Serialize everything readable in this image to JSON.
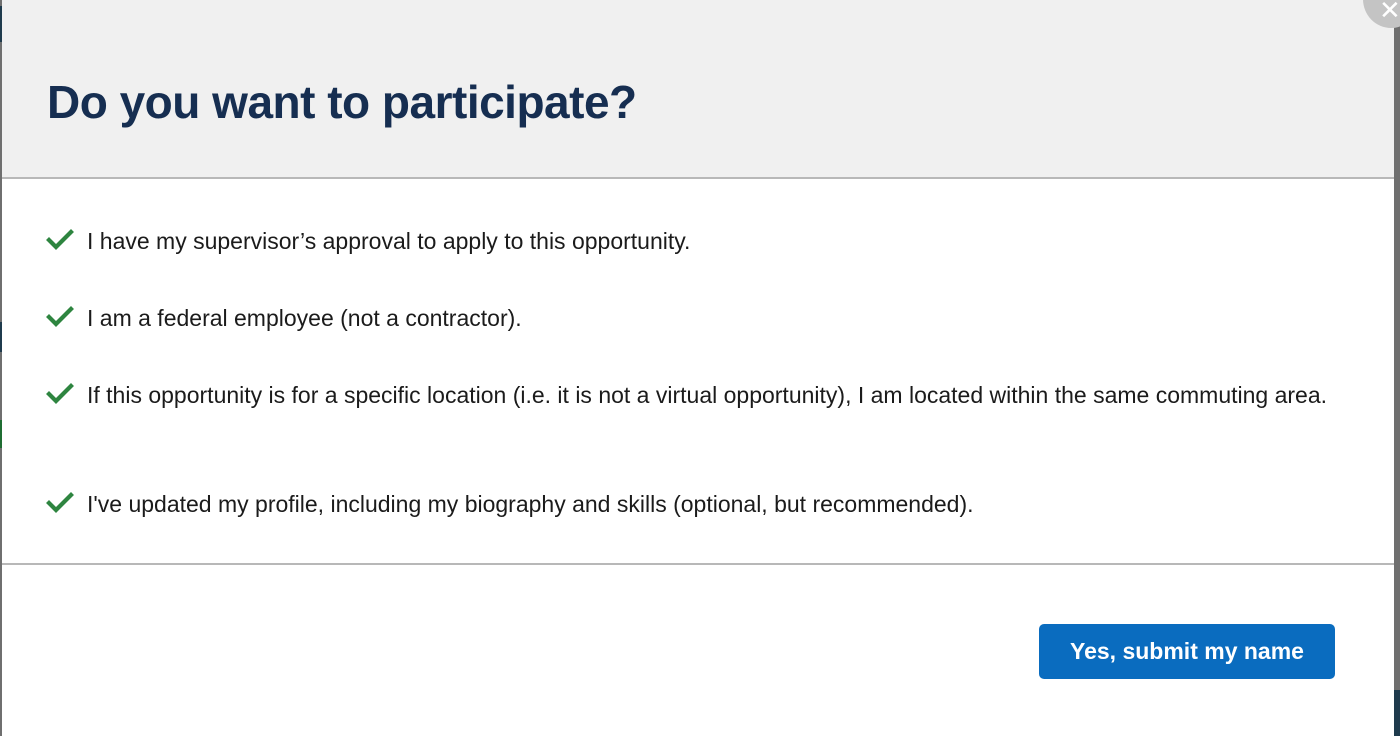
{
  "dialog": {
    "title": "Do you want to participate?",
    "close_label": "✕",
    "checklist": [
      {
        "icon": "checkmark-icon",
        "text": "I have my supervisor’s approval to apply to this opportunity."
      },
      {
        "icon": "checkmark-icon",
        "text": "I am a federal employee (not a contractor)."
      },
      {
        "icon": "checkmark-icon",
        "text": "If this opportunity is for a specific location (i.e. it is not a virtual opportunity), I am located within the same commuting area."
      },
      {
        "icon": "checkmark-icon",
        "text": "I've updated my profile, including my biography and skills (optional, but recommended)."
      }
    ],
    "submit_label": "Yes, submit my name"
  },
  "colors": {
    "title": "#162e51",
    "check": "#2e8540",
    "primary_button": "#0a6cbf",
    "header_background": "#f0f0f0"
  }
}
